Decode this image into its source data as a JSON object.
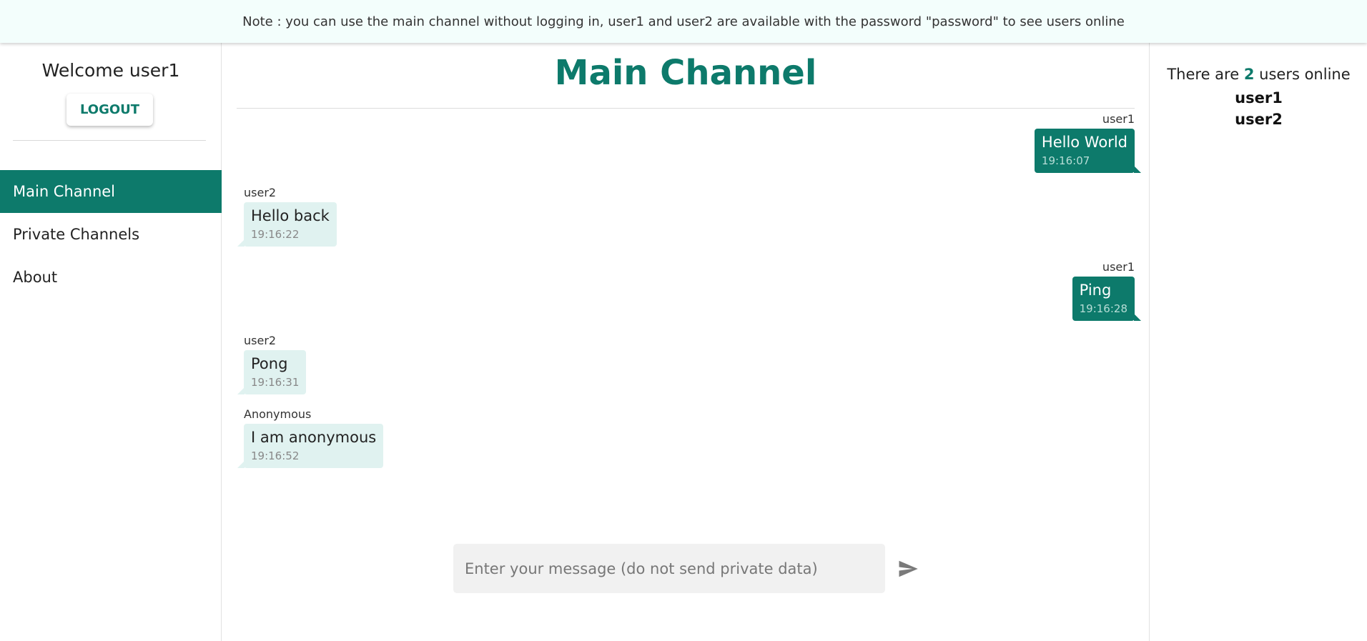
{
  "notice": "Note : you can use the main channel without logging in, user1 and user2 are available with the password \"password\" to see users online",
  "sidebar": {
    "welcome": "Welcome user1",
    "logout": "LOGOUT",
    "nav": [
      {
        "label": "Main Channel",
        "active": true
      },
      {
        "label": "Private Channels",
        "active": false
      },
      {
        "label": "About",
        "active": false
      }
    ]
  },
  "main": {
    "title": "Main Channel",
    "messages": [
      {
        "sender": "user1",
        "text": "Hello World",
        "time": "19:16:07",
        "side": "right"
      },
      {
        "sender": "user2",
        "text": "Hello back",
        "time": "19:16:22",
        "side": "left"
      },
      {
        "sender": "user1",
        "text": "Ping",
        "time": "19:16:28",
        "side": "right"
      },
      {
        "sender": "user2",
        "text": "Pong",
        "time": "19:16:31",
        "side": "left"
      },
      {
        "sender": "Anonymous",
        "text": "I am anonymous",
        "time": "19:16:52",
        "side": "left"
      }
    ],
    "input_placeholder": "Enter your message (do not send private data)"
  },
  "online": {
    "prefix": "There are",
    "count": "2",
    "suffix": "users online",
    "users": [
      "user1",
      "user2"
    ]
  },
  "colors": {
    "accent": "#0d7a6b",
    "received_bubble": "#e0f2f0",
    "notice_bg": "#f3fefc"
  },
  "icons": {
    "send": "send-icon"
  }
}
